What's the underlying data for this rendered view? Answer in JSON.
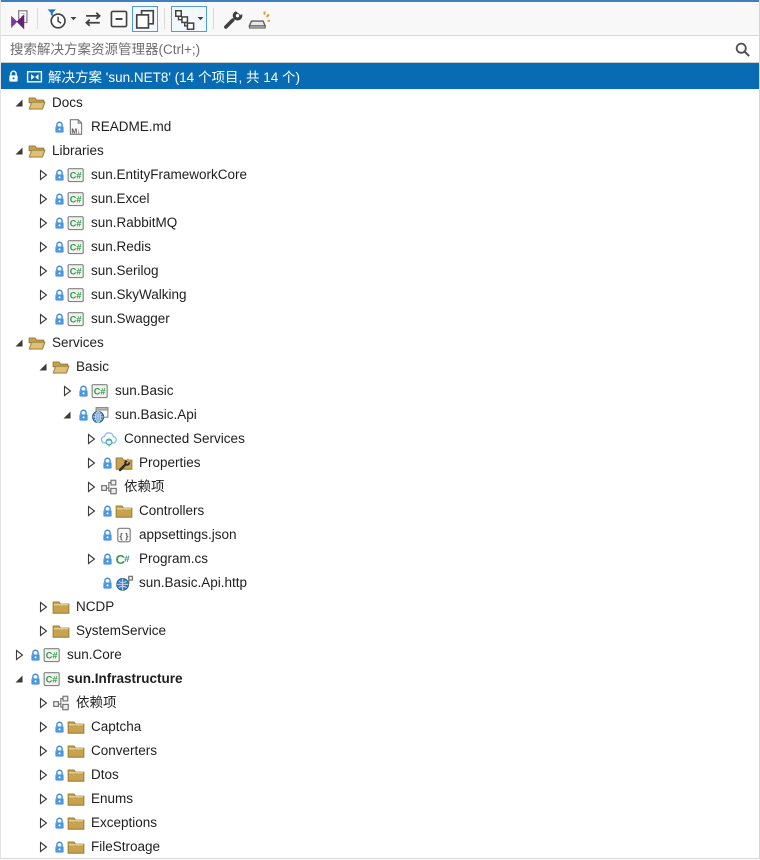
{
  "colors": {
    "accent_top_line": "#3e7fc1",
    "selection_background": "#086cb4",
    "selection_text": "#ffffff",
    "folder": "#c8a24e",
    "csharp_green": "#2f9e44",
    "lock_blue": "#3f8cd6",
    "toolbar_background": "#f8f8f8",
    "tree_text": "#1e1e1e"
  },
  "toolbar": {
    "items": [
      {
        "type": "button",
        "name": "sync-with-active-document",
        "icon": "vs-sync",
        "active": false,
        "dropdown": false
      },
      {
        "type": "separator"
      },
      {
        "type": "button",
        "name": "pending-changes-filter",
        "icon": "clock-filter",
        "active": false,
        "dropdown": true
      },
      {
        "type": "button",
        "name": "sync-selection",
        "icon": "swap-arrows",
        "active": false,
        "dropdown": false
      },
      {
        "type": "button",
        "name": "collapse-all",
        "icon": "collapse-all",
        "active": false,
        "dropdown": false
      },
      {
        "type": "button",
        "name": "show-all-files",
        "icon": "show-all-files",
        "active": true,
        "dropdown": false
      },
      {
        "type": "separator"
      },
      {
        "type": "button",
        "name": "solution-hierarchy-view",
        "icon": "hierarchy",
        "active": true,
        "dropdown": true
      },
      {
        "type": "separator"
      },
      {
        "type": "button",
        "name": "properties",
        "icon": "wrench",
        "active": false,
        "dropdown": false
      },
      {
        "type": "button",
        "name": "preview-selected-items",
        "icon": "preview",
        "active": false,
        "dropdown": false
      }
    ]
  },
  "search": {
    "placeholder": "搜索解决方案资源管理器(Ctrl+;)"
  },
  "solution": {
    "label": "解决方案 'sun.NET8' (14 个项目, 共 14 个)",
    "locked": true,
    "icon": "solution"
  },
  "tree": {
    "items": [
      {
        "label": "Docs",
        "depth": 0,
        "expand": "open",
        "lock": false,
        "icon": "folder-open",
        "bold": false
      },
      {
        "label": "README.md",
        "depth": 1,
        "expand": "none",
        "lock": true,
        "icon": "markdown",
        "bold": false
      },
      {
        "label": "Libraries",
        "depth": 0,
        "expand": "open",
        "lock": false,
        "icon": "folder-open",
        "bold": false
      },
      {
        "label": "sun.EntityFrameworkCore",
        "depth": 1,
        "expand": "closed",
        "lock": true,
        "icon": "csproj",
        "bold": false
      },
      {
        "label": "sun.Excel",
        "depth": 1,
        "expand": "closed",
        "lock": true,
        "icon": "csproj",
        "bold": false
      },
      {
        "label": "sun.RabbitMQ",
        "depth": 1,
        "expand": "closed",
        "lock": true,
        "icon": "csproj",
        "bold": false
      },
      {
        "label": "sun.Redis",
        "depth": 1,
        "expand": "closed",
        "lock": true,
        "icon": "csproj",
        "bold": false
      },
      {
        "label": "sun.Serilog",
        "depth": 1,
        "expand": "closed",
        "lock": true,
        "icon": "csproj",
        "bold": false
      },
      {
        "label": "sun.SkyWalking",
        "depth": 1,
        "expand": "closed",
        "lock": true,
        "icon": "csproj",
        "bold": false
      },
      {
        "label": "sun.Swagger",
        "depth": 1,
        "expand": "closed",
        "lock": true,
        "icon": "csproj",
        "bold": false
      },
      {
        "label": "Services",
        "depth": 0,
        "expand": "open",
        "lock": false,
        "icon": "folder-open",
        "bold": false
      },
      {
        "label": "Basic",
        "depth": 1,
        "expand": "open",
        "lock": false,
        "icon": "folder-open",
        "bold": false
      },
      {
        "label": "sun.Basic",
        "depth": 2,
        "expand": "closed",
        "lock": true,
        "icon": "csproj",
        "bold": false
      },
      {
        "label": "sun.Basic.Api",
        "depth": 2,
        "expand": "open",
        "lock": true,
        "icon": "webapp",
        "bold": false
      },
      {
        "label": "Connected Services",
        "depth": 3,
        "expand": "closed",
        "lock": false,
        "icon": "cloud",
        "bold": false
      },
      {
        "label": "Properties",
        "depth": 3,
        "expand": "closed",
        "lock": true,
        "icon": "properties-folder",
        "bold": false
      },
      {
        "label": "依赖项",
        "depth": 3,
        "expand": "closed",
        "lock": false,
        "icon": "dependencies",
        "bold": false
      },
      {
        "label": "Controllers",
        "depth": 3,
        "expand": "closed",
        "lock": true,
        "icon": "folder",
        "bold": false
      },
      {
        "label": "appsettings.json",
        "depth": 3,
        "expand": "none",
        "lock": true,
        "icon": "json",
        "bold": false
      },
      {
        "label": "Program.cs",
        "depth": 3,
        "expand": "closed",
        "lock": true,
        "icon": "csharp-file",
        "bold": false
      },
      {
        "label": "sun.Basic.Api.http",
        "depth": 3,
        "expand": "none",
        "lock": true,
        "icon": "http",
        "bold": false
      },
      {
        "label": "NCDP",
        "depth": 1,
        "expand": "closed",
        "lock": false,
        "icon": "folder",
        "bold": false
      },
      {
        "label": "SystemService",
        "depth": 1,
        "expand": "closed",
        "lock": false,
        "icon": "folder",
        "bold": false
      },
      {
        "label": "sun.Core",
        "depth": 0,
        "expand": "closed",
        "lock": true,
        "icon": "csproj",
        "bold": false
      },
      {
        "label": "sun.Infrastructure",
        "depth": 0,
        "expand": "open",
        "lock": true,
        "icon": "csproj",
        "bold": true
      },
      {
        "label": "依赖项",
        "depth": 1,
        "expand": "closed",
        "lock": false,
        "icon": "dependencies",
        "bold": false
      },
      {
        "label": "Captcha",
        "depth": 1,
        "expand": "closed",
        "lock": true,
        "icon": "folder",
        "bold": false
      },
      {
        "label": "Converters",
        "depth": 1,
        "expand": "closed",
        "lock": true,
        "icon": "folder",
        "bold": false
      },
      {
        "label": "Dtos",
        "depth": 1,
        "expand": "closed",
        "lock": true,
        "icon": "folder",
        "bold": false
      },
      {
        "label": "Enums",
        "depth": 1,
        "expand": "closed",
        "lock": true,
        "icon": "folder",
        "bold": false
      },
      {
        "label": "Exceptions",
        "depth": 1,
        "expand": "closed",
        "lock": true,
        "icon": "folder",
        "bold": false
      },
      {
        "label": "FileStroage",
        "depth": 1,
        "expand": "closed",
        "lock": true,
        "icon": "folder",
        "bold": false
      }
    ]
  }
}
